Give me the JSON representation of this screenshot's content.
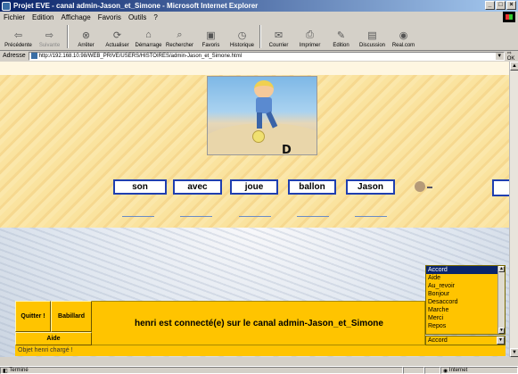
{
  "window": {
    "title": "Projet EVE - canal admin-Jason_et_Simone - Microsoft Internet Explorer",
    "controls": [
      "_",
      "□",
      "×"
    ]
  },
  "menu": [
    "Fichier",
    "Edition",
    "Affichage",
    "Favoris",
    "Outils",
    "?"
  ],
  "toolbar": [
    {
      "label": "Précédente",
      "icon": "back-arrow-icon",
      "glyph": "⇦"
    },
    {
      "label": "Suivante",
      "icon": "forward-arrow-icon",
      "glyph": "⇨",
      "disabled": true
    },
    {
      "label": "Arrêter",
      "icon": "stop-icon",
      "glyph": "⊗"
    },
    {
      "label": "Actualiser",
      "icon": "refresh-icon",
      "glyph": "⟳"
    },
    {
      "label": "Démarrage",
      "icon": "home-icon",
      "glyph": "⌂"
    },
    {
      "label": "Rechercher",
      "icon": "search-icon",
      "glyph": "⌕"
    },
    {
      "label": "Favoris",
      "icon": "favorites-icon",
      "glyph": "▣"
    },
    {
      "label": "Historique",
      "icon": "history-icon",
      "glyph": "◷"
    },
    {
      "label": "Courrier",
      "icon": "mail-icon",
      "glyph": "✉"
    },
    {
      "label": "Imprimer",
      "icon": "print-icon",
      "glyph": "⎙"
    },
    {
      "label": "Edition",
      "icon": "edit-icon",
      "glyph": "✎"
    },
    {
      "label": "Discussion",
      "icon": "discussion-icon",
      "glyph": "▤"
    },
    {
      "label": "Real.com",
      "icon": "real-icon",
      "glyph": "◉"
    }
  ],
  "address": {
    "label": "Adresse",
    "url": "http://192.168.10.98/WEB_PRIVE/USERS/HISTOIRES/admin-Jason_et_Simone.html",
    "go": "OK"
  },
  "scene": {
    "letter": "D"
  },
  "words": [
    "son",
    "avec",
    "joue",
    "ballon",
    "Jason"
  ],
  "buttons": {
    "quit": "Quitter !",
    "babillard": "Babillard",
    "aide": "Aide"
  },
  "message": "henri est connecté(e) sur le canal admin-Jason_et_Simone",
  "commands": {
    "items": [
      "Accord",
      "Aide",
      "Au_revoir",
      "Bonjour",
      "Desaccord",
      "Marche",
      "Merci",
      "Repos"
    ],
    "selected": "Accord"
  },
  "status_line": "Objet henri chargé !",
  "window_status": {
    "left": "Terminé",
    "zone": "Internet"
  }
}
